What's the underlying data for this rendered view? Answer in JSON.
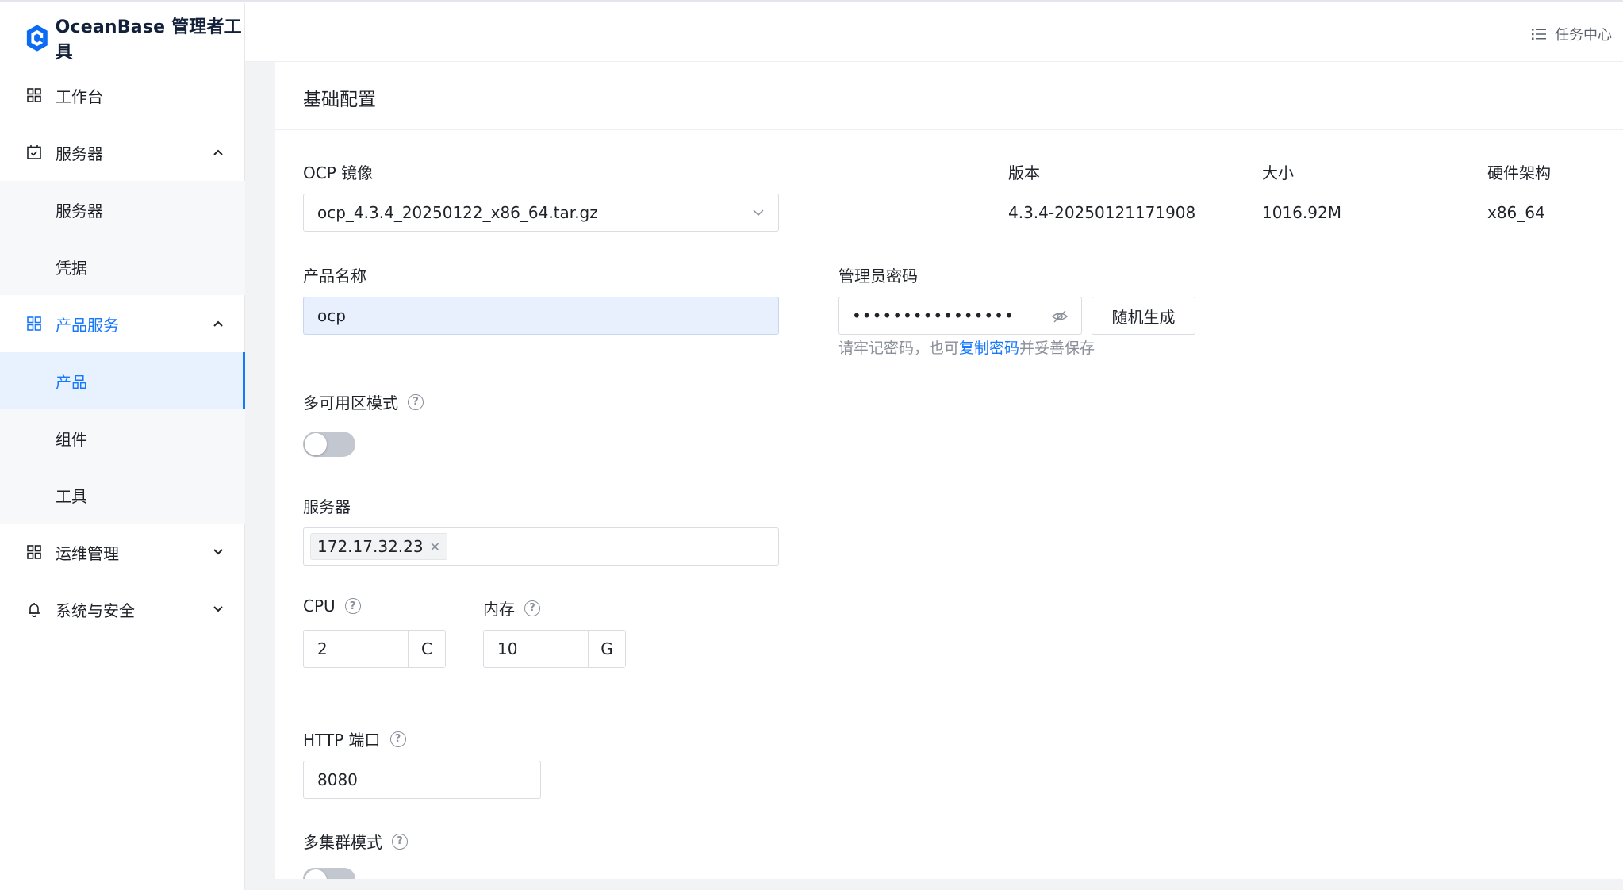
{
  "app": {
    "logo_text": "OceanBase 管理者工具"
  },
  "header": {
    "task_center": "任务中心"
  },
  "sidebar": {
    "workbench": "工作台",
    "servers_group": "服务器",
    "servers_sub": [
      "服务器",
      "凭据"
    ],
    "products_group": "产品服务",
    "products_sub": [
      "产品",
      "组件",
      "工具"
    ],
    "ops": "运维管理",
    "security": "系统与安全"
  },
  "form": {
    "section_title": "基础配置",
    "ocp_image_label": "OCP 镜像",
    "ocp_image_value": "ocp_4.3.4_20250122_x86_64.tar.gz",
    "version_label": "版本",
    "version_value": "4.3.4-20250121171908",
    "size_label": "大小",
    "size_value": "1016.92M",
    "arch_label": "硬件架构",
    "arch_value": "x86_64",
    "product_name_label": "产品名称",
    "product_name_value": "ocp",
    "admin_password_label": "管理员密码",
    "admin_password_value": "••••••••••••••••",
    "random_button": "随机生成",
    "password_hint_prefix": "请牢记密码，也可",
    "password_hint_link": "复制密码",
    "password_hint_suffix": "并妥善保存",
    "multi_az_label": "多可用区模式",
    "servers_label": "服务器",
    "server_tag": "172.17.32.23",
    "cpu_label": "CPU",
    "cpu_value": "2",
    "cpu_unit": "C",
    "memory_label": "内存",
    "memory_value": "10",
    "memory_unit": "G",
    "http_port_label": "HTTP 端口",
    "http_port_value": "8080",
    "multi_cluster_label": "多集群模式"
  },
  "colors": {
    "accent": "#1677ff",
    "sidebar_active_bg": "#e8f2ff",
    "page_bg": "#f2f3f5"
  }
}
